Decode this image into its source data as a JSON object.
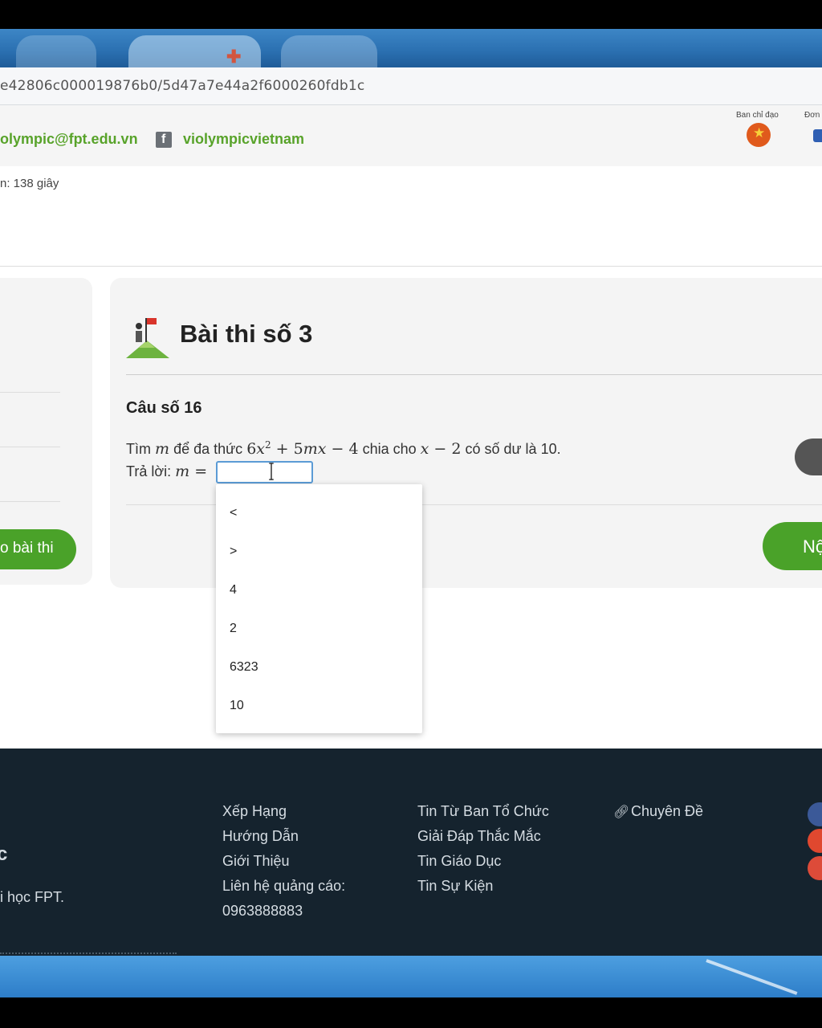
{
  "browser": {
    "url": "e42806c000019876b0/5d47a7e44a2f6000260fdb1c"
  },
  "infobar": {
    "email": "olympic@fpt.edu.vn",
    "facebook": "violympicvietnam",
    "sponsor_label": "Ban chỉ đạo",
    "sponsor_label2": "Đơn"
  },
  "timer": "n: 138 giây",
  "left_panel": {
    "submit_label": "o bài thi"
  },
  "exam": {
    "title": "Bài thi số 3",
    "question_number": "Câu số 16",
    "question": {
      "p1": "Tìm",
      "var_m": "m",
      "p2": "để đa thức",
      "poly_a": "6",
      "poly_x": "x",
      "poly_exp": "2",
      "poly_b": " + 5",
      "poly_mx": "mx",
      "poly_c": " − 4",
      "p3": "chia cho",
      "div_x": "x",
      "div_c": " − 2",
      "p4": "có số dư là 10."
    },
    "answer_label": "Trả lời:",
    "answer_var": "m",
    "answer_eq": " =",
    "answer_value": "",
    "submit_label": "Nộ"
  },
  "autocomplete": {
    "options": [
      "<",
      ">",
      "4",
      "2",
      "6323",
      "10"
    ]
  },
  "footer": {
    "col_left_partial1": "c",
    "col_left_partial2": "i học FPT.",
    "col1": [
      "Xếp Hạng",
      "Hướng Dẫn",
      "Giới Thiệu",
      "Liên hệ quảng cáo:",
      "0963888883"
    ],
    "col2": [
      "Tin Từ Ban Tổ Chức",
      "Giải Đáp Thắc Mắc",
      "Tin Giáo Dục",
      "Tin Sự Kiện"
    ],
    "col3": [
      "Chuyên Đề"
    ]
  },
  "colors": {
    "green": "#4aa229",
    "footer_bg": "#15232e",
    "focus_blue": "#5b9bd5"
  }
}
